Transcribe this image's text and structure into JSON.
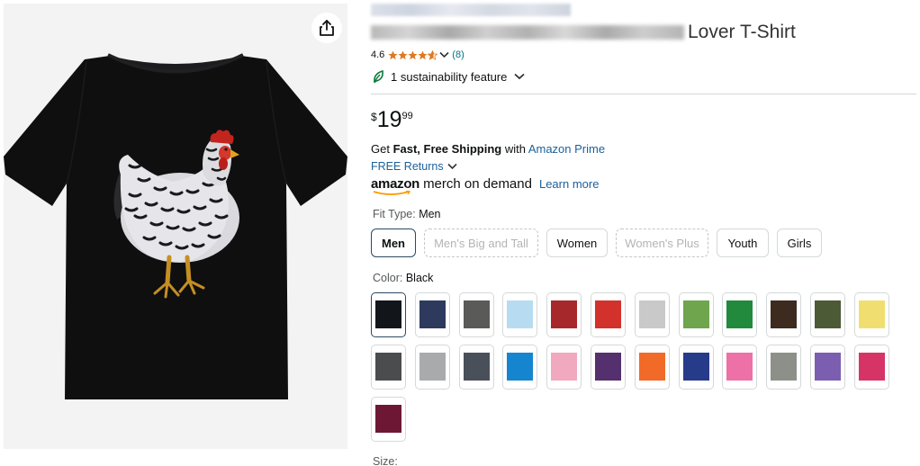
{
  "product": {
    "title_visible": "Lover T-Shirt",
    "rating": "4.6",
    "rating_count": "(8)",
    "sustainability": "1 sustainability feature"
  },
  "price": {
    "symbol": "$",
    "whole": "19",
    "fraction": "99"
  },
  "shipping": {
    "prefix": "Get ",
    "bold": "Fast, Free Shipping",
    "middle": " with ",
    "prime_link": "Amazon Prime",
    "returns": "FREE Returns"
  },
  "merch": {
    "amazon": "amazon",
    "text": "merch on demand",
    "learn_more": "Learn more"
  },
  "fit": {
    "label": "Fit Type: ",
    "selected": "Men",
    "options": [
      "Men",
      "Men's Big and Tall",
      "Women",
      "Women's Plus",
      "Youth",
      "Girls"
    ],
    "disabled": [
      "Men's Big and Tall",
      "Women's Plus"
    ]
  },
  "color": {
    "label": "Color: ",
    "selected": "Black",
    "swatches": [
      "#12161a",
      "#2d3a5e",
      "#5a5a58",
      "#b7dcf1",
      "#a7282a",
      "#d3312c",
      "#c9c9c9",
      "#6ea54d",
      "#218a3c",
      "#3d2b1f",
      "#4c5a36",
      "#f0df70",
      "#4b4c4e",
      "#a9aaac",
      "#4a505a",
      "#1585d0",
      "#f0a9bf",
      "#55306e",
      "#f26a27",
      "#273b8b",
      "#ed70a6",
      "#8c9089",
      "#7b5eb0",
      "#d63467",
      "#6e1735"
    ]
  },
  "size": {
    "label": "Size:"
  },
  "icons": [
    "share-icon",
    "star-icon",
    "chevron-down-icon",
    "leaf-icon"
  ],
  "colors": {
    "accent": "#007185",
    "link": "#1c5f9a",
    "star": "#de7921",
    "selected_border": "#2b4a63"
  }
}
